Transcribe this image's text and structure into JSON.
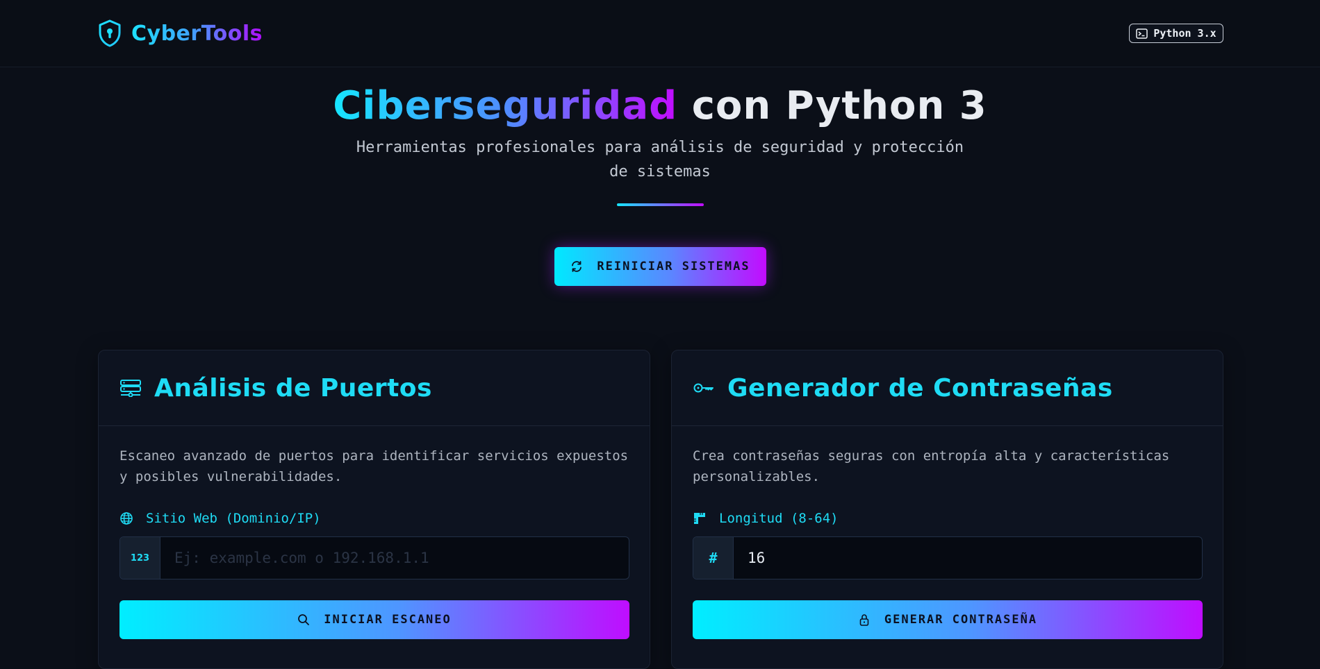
{
  "navbar": {
    "brand": "CyberTools",
    "badge": "Python 3.x"
  },
  "hero": {
    "title_highlight": "Ciberseguridad",
    "title_rest": " con Python 3",
    "subtitle": "Herramientas profesionales para análisis de seguridad y protección de sistemas",
    "reset_button": "REINICIAR SISTEMAS"
  },
  "cards": {
    "ports": {
      "title": "Análisis de Puertos",
      "description": "Escaneo avanzado de puertos para identificar servicios expuestos y posibles vulnerabilidades.",
      "label": "Sitio Web (Dominio/IP)",
      "prefix": "123",
      "placeholder": "Ej: example.com o 192.168.1.1",
      "value": "",
      "button": "INICIAR ESCANEO"
    },
    "password": {
      "title": "Generador de Contraseñas",
      "description": "Crea contraseñas seguras con entropía alta y características personalizables.",
      "label": "Longitud (8-64)",
      "prefix": "#",
      "placeholder": "",
      "value": "16",
      "button": "GENERAR CONTRASEÑA"
    }
  },
  "icons": {
    "brand": "shield-keyhole-icon",
    "badge": "terminal-icon",
    "reset": "refresh-icon",
    "ports_header": "server-network-icon",
    "password_header": "key-icon",
    "ports_label": "globe-icon",
    "password_label": "ruler-icon",
    "scan_button": "search-icon",
    "generate_button": "lock-icon"
  },
  "colors": {
    "background": "#0b0f18",
    "accent_cyan": "#1fdcf5",
    "accent_purple": "#c20cff",
    "card": "#0d1320"
  }
}
